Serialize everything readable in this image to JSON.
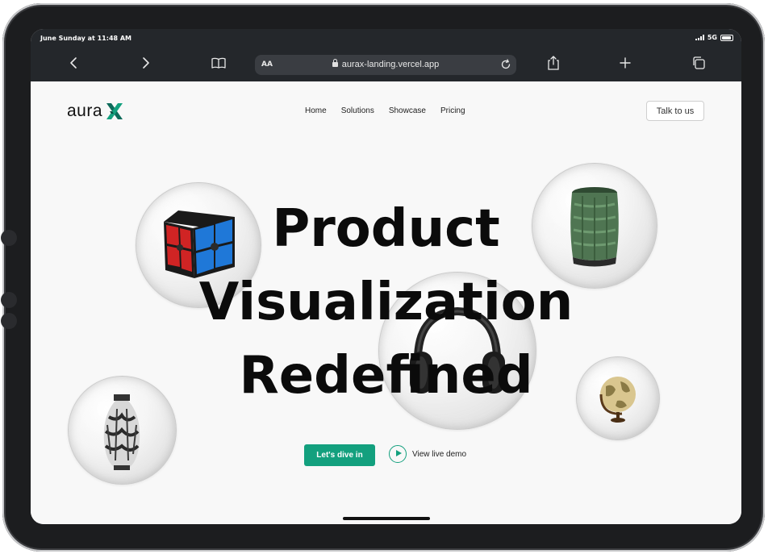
{
  "status_bar": {
    "time": "June Sunday at 11:48 AM",
    "network": "5G"
  },
  "browser": {
    "aa_label": "AA",
    "url": "aurax-landing.vercel.app"
  },
  "site": {
    "logo_text": "aura",
    "nav": [
      "Home",
      "Solutions",
      "Showcase",
      "Pricing"
    ],
    "talk_button": "Talk to us",
    "headline": [
      "Product",
      "Visualization",
      "Redefined"
    ],
    "cta_primary": "Let's dive in",
    "cta_secondary": "View live demo"
  },
  "colors": {
    "accent": "#13a07e",
    "chrome": "#24272b"
  }
}
